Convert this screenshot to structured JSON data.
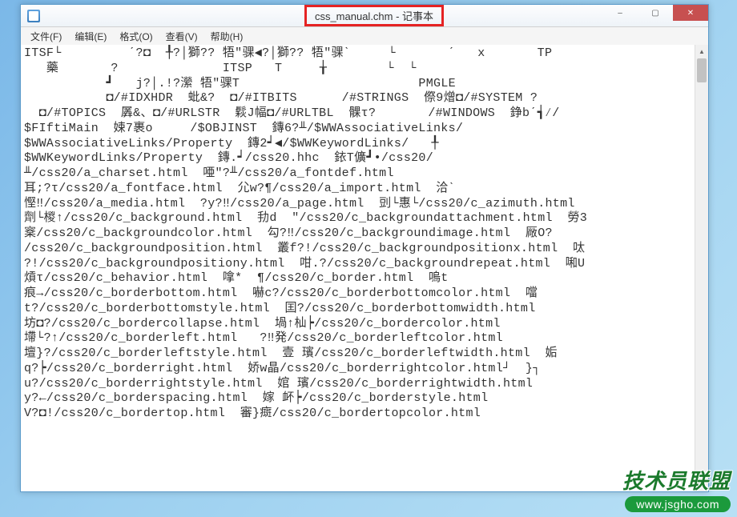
{
  "window": {
    "title": "css_manual.chm - 记事本"
  },
  "controls": {
    "minimize": "–",
    "maximize": "▢",
    "close": "✕"
  },
  "menu": {
    "file": "文件(F)",
    "edit": "编辑(E)",
    "format": "格式(O)",
    "view": "查看(V)",
    "help": "帮助(H)"
  },
  "content": "ITSF└         ˊ?◘  ╀?│獅?? 牾\"骒◀?│獅?? 牾\"骒ˋ     └       ˊ   x       TP\n   藥       ?              ITSP   T     ╁        └  └\n           ┛   j?│.!?瀠 牾\"骒T                        PMGLE\n           ◘/#IDXHDR  蚍&?  ◘/#ITBITS      /#STRINGS  傺9熷◘/#SYSTEM ?\n  ◘/#TOPICS  羼&、◘/#URLSTR  鬏J幅◘/#URLTBL  髁τ?       /#WINDOWS  錚bˊ┪∕/\n$FIftiMain  娕7裹o     /$OBJINST  鏄6?╨/$WWAssociativeLinks/\n$WWAssociativeLinks/Property  鏄2┙◀/$WWKeywordLinks/   ╀\n$WWKeywordLinks/Property  鏄.┙/css20.hhc  銥T儣┛•/css20/\n╨/css20/a_charset.html  唖\"?╨/css20/a_fontdef.html\n耳;?τ/css20/a_fontface.html  尣w?¶/css20/a_import.html  洽ˋ\n慳‼/css20/a_media.html  ?y?‼/css20/a_page.html  剅└惠└/css20/c_azimuth.html\n劑└椶↑/css20/c_background.html  劧d  \"/css20/c_backgroundattachment.html  勞3\n㮤/css20/c_backgroundcolor.html  勾?‼/css20/c_backgroundimage.html  厰O?\n/css20/c_backgroundposition.html  叢f?!/css20/c_backgroundpositionx.html  呔\n?!/css20/c_backgroundpositiony.html  咁.?/css20/c_backgroundrepeat.html  啝U\n熕τ/css20/c_behavior.html  嗱*  ¶/css20/c_border.html  嗚t\n痕→/css20/c_borderbottom.html  嚇c?/css20/c_borderbottomcolor.html  噹\nt?/css20/c_borderbottomstyle.html  囯?/css20/c_borderbottomwidth.html\n坊◘?/css20/c_bordercollapse.html  堝↑杣┝/css20/c_bordercolor.html\n墆└?↑/css20/c_borderleft.html   ?‼発/css20/c_borderleftcolor.html\n壇}?/css20/c_borderleftstyle.html  壹 璸/css20/c_borderleftwidth.html  姤\nq?┝/css20/c_borderright.html  娇w晶/css20/c_borderrightcolor.html┘  }┐\nu?/css20/c_borderrightstyle.html  婠 璸/css20/c_borderrightwidth.html\ny?←/css20/c_borderspacing.html  嫁 衃┝/css20/c_borderstyle.html\nV?◘!/css20/c_bordertop.html  審}癍/css20/c_bordertopcolor.html",
  "scrollbar": {
    "up": "▲",
    "down": "▼"
  },
  "watermark": {
    "brand": "技术员联盟",
    "url": "www.jsgho.com"
  }
}
